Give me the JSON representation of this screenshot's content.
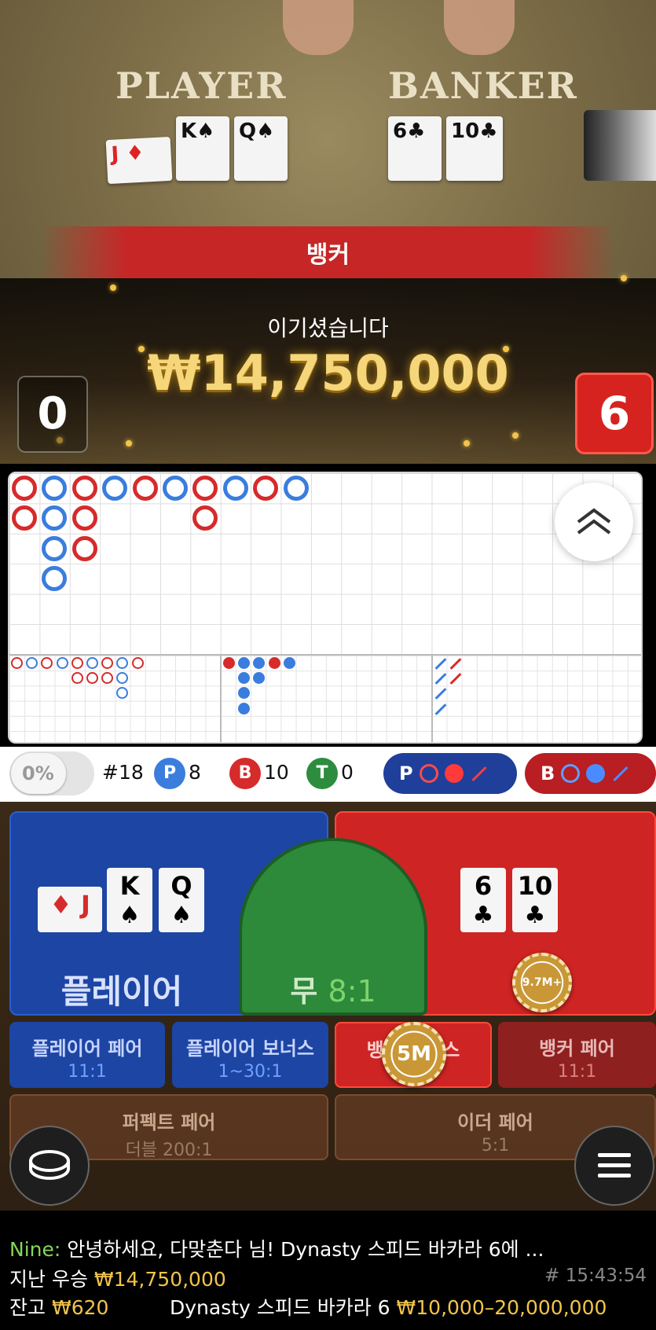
{
  "video": {
    "player_label": "PLAYER",
    "banker_label": "BANKER",
    "player_cards": [
      {
        "rank": "J",
        "suit": "♦",
        "color": "red"
      },
      {
        "rank": "K",
        "suit": "♠",
        "color": "black"
      },
      {
        "rank": "Q",
        "suit": "♠",
        "color": "black"
      }
    ],
    "banker_cards": [
      {
        "rank": "6",
        "suit": "♣",
        "color": "black"
      },
      {
        "rank": "10",
        "suit": "♣",
        "color": "black"
      }
    ]
  },
  "result": {
    "banner": "뱅커",
    "win_text": "이기셨습니다",
    "win_amount": "₩14,750,000",
    "player_score": "0",
    "banker_score": "6"
  },
  "roadmap": {
    "big_road": [
      [
        "B",
        0,
        0
      ],
      [
        "B",
        0,
        1
      ],
      [
        "P",
        1,
        0
      ],
      [
        "P",
        1,
        1
      ],
      [
        "P",
        1,
        2
      ],
      [
        "P",
        1,
        3
      ],
      [
        "B",
        2,
        0
      ],
      [
        "B",
        2,
        1
      ],
      [
        "B",
        2,
        2
      ],
      [
        "P",
        3,
        0
      ],
      [
        "B",
        4,
        0
      ],
      [
        "P",
        5,
        0
      ],
      [
        "B",
        6,
        0
      ],
      [
        "B",
        6,
        1
      ],
      [
        "P",
        7,
        0
      ],
      [
        "B",
        8,
        0
      ],
      [
        "P",
        9,
        0
      ]
    ],
    "big_eye": [
      [
        "B",
        0,
        0
      ],
      [
        "P",
        1,
        0
      ],
      [
        "B",
        2,
        0
      ],
      [
        "P",
        3,
        0
      ],
      [
        "B",
        4,
        0
      ],
      [
        "B",
        4,
        1
      ],
      [
        "P",
        5,
        0
      ],
      [
        "B",
        5,
        1
      ],
      [
        "B",
        6,
        0
      ],
      [
        "B",
        6,
        1
      ],
      [
        "P",
        7,
        0
      ],
      [
        "P",
        7,
        1
      ],
      [
        "P",
        7,
        2
      ],
      [
        "B",
        8,
        0
      ]
    ],
    "small_road": [
      [
        "B",
        0,
        0
      ],
      [
        "P",
        1,
        0
      ],
      [
        "P",
        1,
        1
      ],
      [
        "P",
        1,
        2
      ],
      [
        "P",
        1,
        3
      ],
      [
        "P",
        2,
        0
      ],
      [
        "P",
        2,
        1
      ],
      [
        "B",
        3,
        0
      ],
      [
        "P",
        4,
        0
      ]
    ],
    "cockroach": [
      [
        "P",
        0,
        0
      ],
      [
        "P",
        0,
        1
      ],
      [
        "P",
        0,
        2
      ],
      [
        "P",
        0,
        3
      ],
      [
        "B",
        1,
        0
      ],
      [
        "B",
        1,
        1
      ]
    ]
  },
  "stats": {
    "percent": "0%",
    "round": "#18",
    "player_letter": "P",
    "player_count": "8",
    "banker_letter": "B",
    "banker_count": "10",
    "tie_letter": "T",
    "tie_count": "0",
    "predict_player": "P",
    "predict_banker": "B"
  },
  "bets": {
    "player_label": "플레이어",
    "tie_label": "무",
    "tie_odds": "8:1",
    "banker_chip": "9.7M+",
    "player_hand": [
      {
        "rank": "J",
        "suit": "♦"
      },
      {
        "rank": "K",
        "suit": "♠"
      },
      {
        "rank": "Q",
        "suit": "♠"
      }
    ],
    "banker_hand": [
      {
        "rank": "6",
        "suit": "♣"
      },
      {
        "rank": "10",
        "suit": "♣"
      }
    ],
    "side": {
      "player_pair": {
        "label": "플레이어 페어",
        "odds": "11:1"
      },
      "player_bonus": {
        "label": "플레이어 보너스",
        "odds": "1~30:1"
      },
      "banker_bonus": {
        "label": "뱅커 보너스",
        "chip": "5M"
      },
      "banker_pair": {
        "label": "뱅커 페어",
        "odds": "11:1"
      },
      "perfect_pair": {
        "label": "퍼펙트 페어",
        "odds": "더블 200:1"
      },
      "either_pair": {
        "label": "이더 페어",
        "odds": "5:1"
      }
    }
  },
  "footer": {
    "chat_user": "Nine:",
    "chat_message": " 안녕하세요, 다맞춘다 님! Dynasty 스피드 바카라 6에 ...",
    "last_win_label": "지난 우승",
    "last_win_value": "₩14,750,000",
    "round_id": "# 15:43:54",
    "balance_label": "잔고",
    "balance_value": "₩620",
    "table_name": "Dynasty 스피드 바카라 6",
    "table_limits": "₩10,000–20,000,000"
  },
  "colors": {
    "player": "#3a7ddd",
    "banker": "#d62b2b",
    "tie": "#2e8c3e",
    "gold": "#f2c44a"
  }
}
